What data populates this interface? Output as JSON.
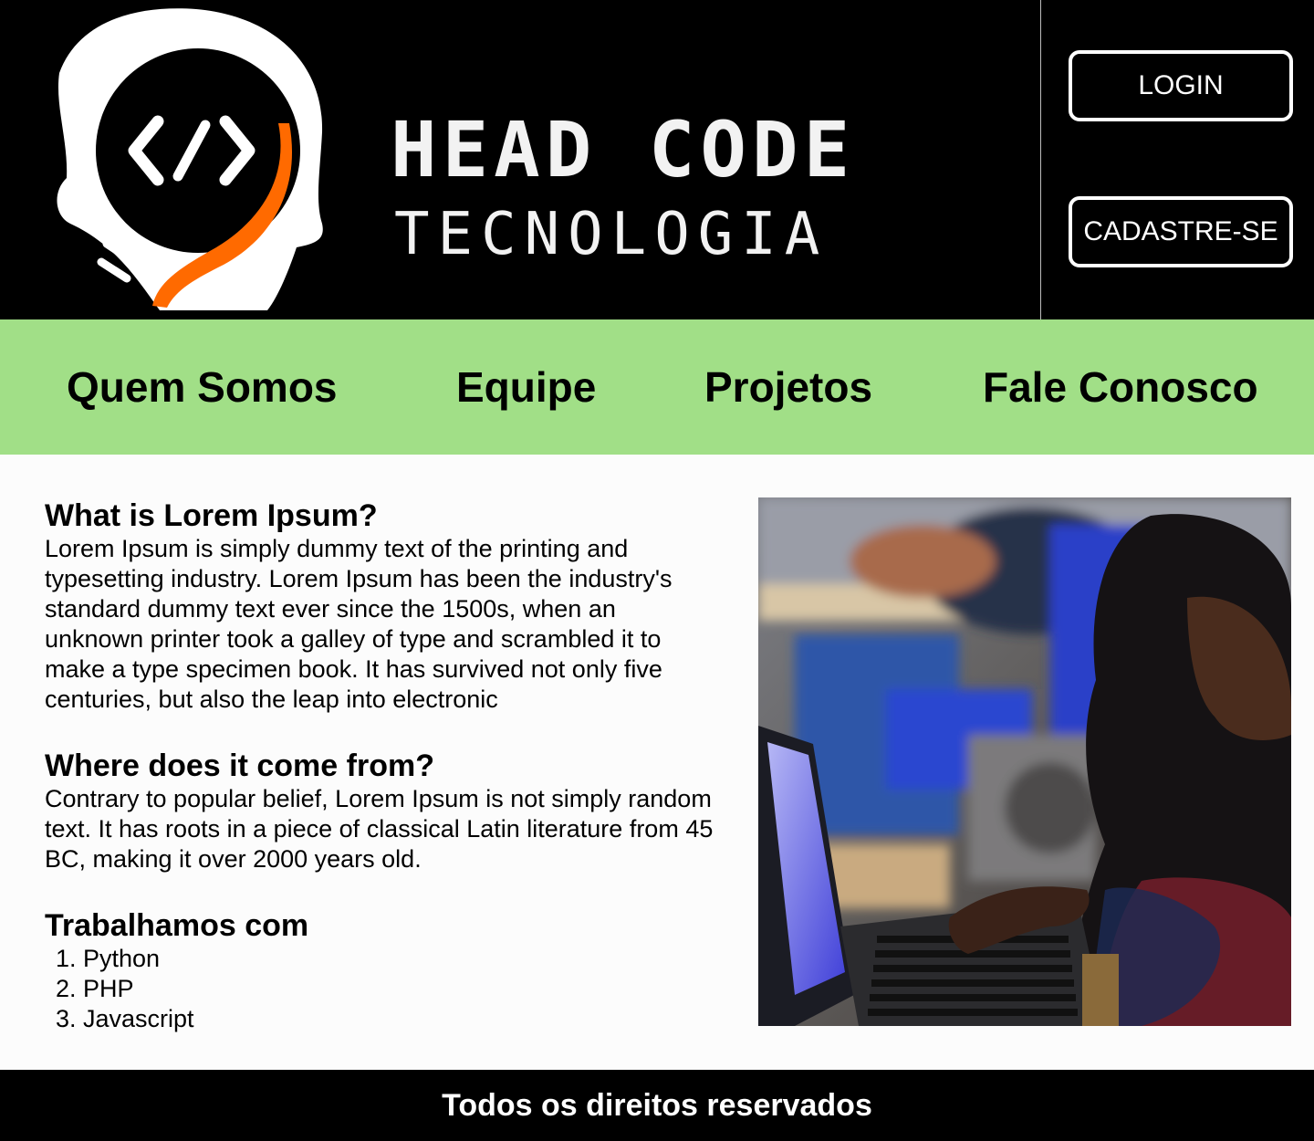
{
  "header": {
    "brand_line1": "HEAD CODE",
    "brand_line2": "TECNOLOGIA",
    "login_label": "LOGIN",
    "signup_label": "CADASTRE-SE",
    "logo_icon": "head-code-icon",
    "accent_color": "#ff6a00"
  },
  "nav": {
    "items": [
      {
        "label": "Quem Somos"
      },
      {
        "label": "Equipe"
      },
      {
        "label": "Projetos"
      },
      {
        "label": "Fale Conosco"
      }
    ],
    "background": "#a1df87"
  },
  "main": {
    "section1": {
      "title": "What is Lorem Ipsum?",
      "body": "Lorem Ipsum is simply dummy text of the printing and typesetting industry. Lorem Ipsum has been the industry's standard dummy text ever since the 1500s, when an unknown printer took a galley of type and scrambled it to make a type specimen book. It has survived not only five centuries, but also the leap into electronic"
    },
    "section2": {
      "title": "Where does it come from?",
      "body": "Contrary to popular belief, Lorem Ipsum is not simply random text. It has roots in a piece of classical Latin literature from 45 BC, making it over 2000 years old."
    },
    "section3": {
      "title": "Trabalhamos com",
      "items": [
        "Python",
        "PHP",
        "Javascript"
      ]
    }
  },
  "footer": {
    "text": "Todos os direitos reservados"
  }
}
